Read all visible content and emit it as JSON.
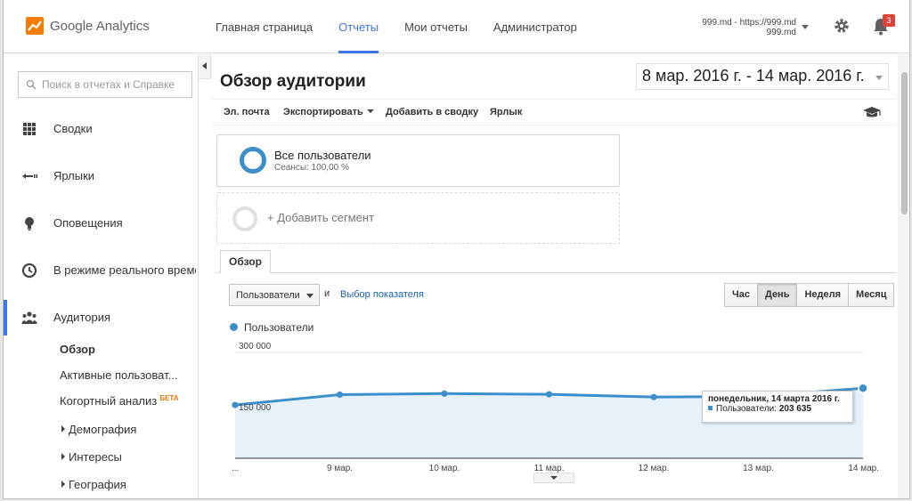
{
  "header": {
    "logo_text": "Google Analytics",
    "nav": [
      "Главная страница",
      "Отчеты",
      "Мои отчеты",
      "Администратор"
    ],
    "active_nav": "Отчеты",
    "account_line1": "999.md - https://999.md",
    "account_line2": "999.md",
    "notifications_count": "3",
    "icons": [
      "analytics-logo-icon",
      "gear-icon",
      "bell-icon"
    ]
  },
  "sidebar": {
    "search_placeholder": "Поиск в отчетах и Справке",
    "items": [
      {
        "label": "Сводки",
        "icon": "grid-icon"
      },
      {
        "label": "Ярлыки",
        "icon": "shortcut-icon"
      },
      {
        "label": "Оповещения",
        "icon": "lightbulb-icon"
      },
      {
        "label": "В режиме реального времени",
        "icon": "clock-icon"
      },
      {
        "label": "Аудитория",
        "icon": "people-icon"
      }
    ],
    "sub_items": [
      "Обзор",
      "Активные пользоват...",
      "Когортный анализ",
      "Демография",
      "Интересы",
      "География"
    ],
    "beta_label": "БЕТА"
  },
  "main": {
    "title": "Обзор аудитории",
    "date_range": "8 мар. 2016 г. - 14 мар. 2016 г.",
    "toolbar": {
      "email": "Эл. почта",
      "export": "Экспортировать",
      "add_dashboard": "Добавить в сводку",
      "shortcut": "Ярлык"
    },
    "segment": {
      "name": "Все пользователи",
      "sub": "Сеансы: 100,00 %"
    },
    "add_segment": "+ Добавить сегмент",
    "tab": "Обзор",
    "metric": "Пользователи",
    "and": "и",
    "pick_metric": "Выбор показателя",
    "granularity": [
      "Час",
      "День",
      "Неделя",
      "Месяц"
    ],
    "active_granularity": "День",
    "tooltip": {
      "date": "понедельник, 14 марта 2016 г.",
      "label": "Пользователи:",
      "value": "203 635"
    }
  },
  "chart_data": {
    "type": "area",
    "series": [
      {
        "name": "Пользователи",
        "values": [
          155000,
          185000,
          188000,
          186000,
          178000,
          180000,
          203635
        ]
      }
    ],
    "categories": [
      "...",
      "9 мар.",
      "10 мар.",
      "11 мар.",
      "12 мар.",
      "13 мар.",
      "14 мар."
    ],
    "y_ticks": [
      "300 000",
      "150 000"
    ],
    "ylim": [
      0,
      300000
    ],
    "color": "#3d8fcc",
    "fill": "#e6f1fa"
  }
}
